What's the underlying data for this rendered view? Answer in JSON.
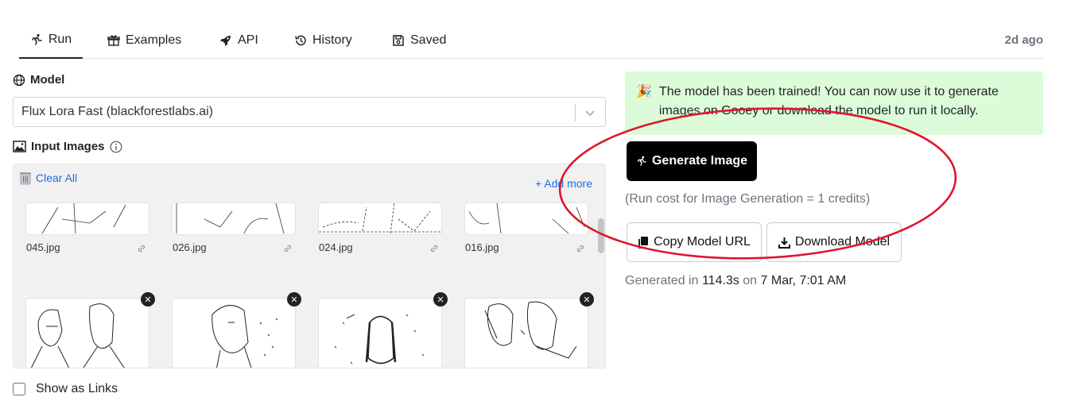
{
  "tabs": [
    {
      "label": "Run",
      "icon": "running-person-icon",
      "active": true
    },
    {
      "label": "Examples",
      "icon": "gift-icon"
    },
    {
      "label": "API",
      "icon": "rocket-icon"
    },
    {
      "label": "History",
      "icon": "history-icon"
    },
    {
      "label": "Saved",
      "icon": "save-icon"
    }
  ],
  "time_ago": "2d ago",
  "model": {
    "label": "Model",
    "selected": "Flux Lora Fast (blackforestlabs.ai)"
  },
  "input_images": {
    "label": "Input Images",
    "clear_all": "Clear All",
    "add_more": "+ Add more",
    "files": [
      "045.jpg",
      "026.jpg",
      "024.jpg",
      "016.jpg"
    ]
  },
  "show_as_links": {
    "label": "Show as Links",
    "checked": false
  },
  "alert": {
    "emoji": "🎉",
    "text": "The model has been trained! You can now use it to generate images on Gooey or download the model to run it locally."
  },
  "generate_button": "Generate Image",
  "run_cost": "(Run cost for Image Generation = 1 credits)",
  "copy_button": "Copy Model URL",
  "download_button": "Download Model",
  "generated": {
    "prefix": "Generated in",
    "duration": "114.3s",
    "on": "on",
    "date": "7 Mar, 7:01 AM"
  },
  "colors": {
    "annotation_circle": "#e0142d",
    "alert_bg": "#dcfcd9",
    "link": "#1e6fd9"
  }
}
